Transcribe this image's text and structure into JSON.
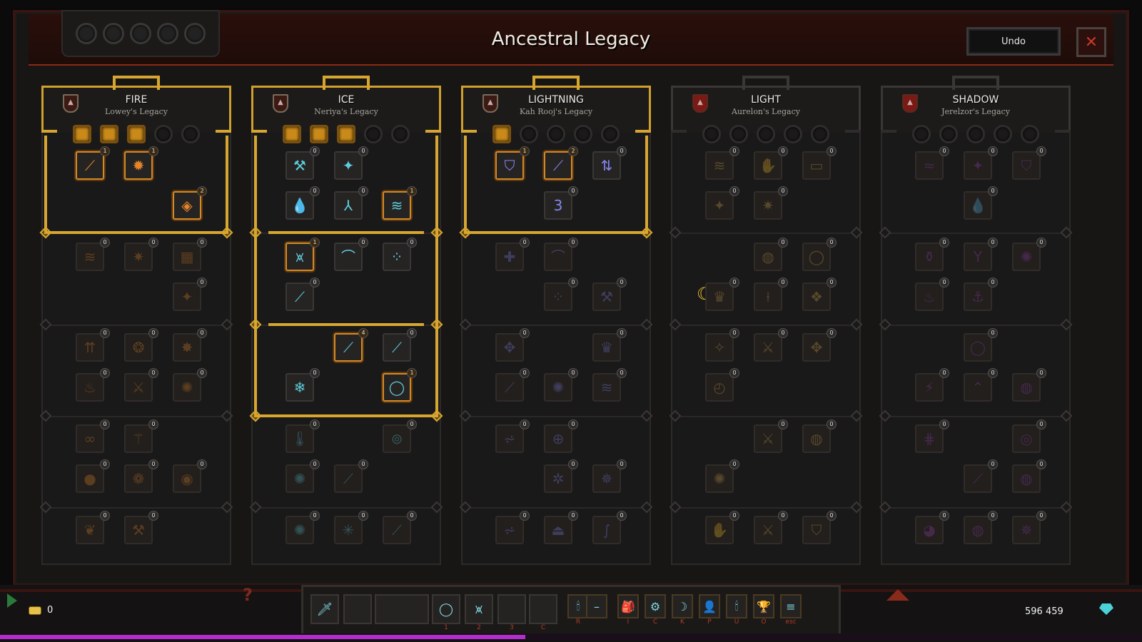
{
  "window": {
    "title": "Ancestral Legacy",
    "undo_label": "Undo",
    "close_icon": "✕"
  },
  "bottom": {
    "gold": "0",
    "currency": "596 459",
    "help": "?",
    "xp_fraction": 0.46
  },
  "hotbar": [
    {
      "key": "",
      "icon": "🗡"
    },
    {
      "key": "",
      "icon": ""
    },
    {
      "key": "",
      "icon": ""
    },
    {
      "key": "1",
      "icon": "◯"
    },
    {
      "key": "2",
      "icon": "⩙"
    },
    {
      "key": "3",
      "icon": ""
    },
    {
      "key": "C",
      "icon": ""
    },
    {
      "key": "R",
      "icon": "🕯"
    },
    {
      "key": "",
      "icon": "–"
    },
    {
      "key": "I",
      "icon": "🎒"
    },
    {
      "key": "C",
      "icon": "⚙"
    },
    {
      "key": "K",
      "icon": "☽"
    },
    {
      "key": "P",
      "icon": "👤"
    },
    {
      "key": "U",
      "icon": "🕯"
    },
    {
      "key": "O",
      "icon": "🏆"
    },
    {
      "key": "esc",
      "icon": "≡"
    }
  ],
  "columns": [
    {
      "id": "fire",
      "name": "FIRE",
      "legacy": "Lowey's Legacy",
      "color": "#f08a2a",
      "skills": [
        {
          "r": 0,
          "c": 0,
          "n": 1,
          "g": "⟋",
          "own": true
        },
        {
          "r": 0,
          "c": 1,
          "n": 1,
          "g": "✹",
          "own": true
        },
        {
          "r": 1,
          "c": 2,
          "n": 2,
          "g": "◈",
          "own": true
        },
        {
          "r": 2,
          "c": 0,
          "n": 0,
          "g": "≋"
        },
        {
          "r": 2,
          "c": 1,
          "n": 0,
          "g": "✷"
        },
        {
          "r": 2,
          "c": 2,
          "n": 0,
          "g": "▦"
        },
        {
          "r": 3,
          "c": 2,
          "n": 0,
          "g": "✦"
        },
        {
          "r": 4,
          "c": 0,
          "n": 0,
          "g": "⇈"
        },
        {
          "r": 4,
          "c": 1,
          "n": 0,
          "g": "❂"
        },
        {
          "r": 4,
          "c": 2,
          "n": 0,
          "g": "✸"
        },
        {
          "r": 5,
          "c": 0,
          "n": 0,
          "g": "♨"
        },
        {
          "r": 5,
          "c": 1,
          "n": 0,
          "g": "⚔"
        },
        {
          "r": 5,
          "c": 2,
          "n": 0,
          "g": "✺"
        },
        {
          "r": 6,
          "c": 0,
          "n": 0,
          "g": "∞"
        },
        {
          "r": 6,
          "c": 1,
          "n": 0,
          "g": "⚚"
        },
        {
          "r": 7,
          "c": 0,
          "n": 0,
          "g": "●"
        },
        {
          "r": 7,
          "c": 1,
          "n": 0,
          "g": "❁"
        },
        {
          "r": 7,
          "c": 2,
          "n": 0,
          "g": "◉"
        },
        {
          "r": 8,
          "c": 0,
          "n": 0,
          "g": "❦"
        },
        {
          "r": 8,
          "c": 1,
          "n": 0,
          "g": "⚒"
        }
      ]
    },
    {
      "id": "ice",
      "name": "ICE",
      "legacy": "Neriya's Legacy",
      "color": "#5fd6e8",
      "skills": [
        {
          "r": 0,
          "c": 0,
          "n": 0,
          "g": "⚒",
          "lit": true
        },
        {
          "r": 0,
          "c": 1,
          "n": 0,
          "g": "✦",
          "lit": true
        },
        {
          "r": 1,
          "c": 0,
          "n": 0,
          "g": "💧",
          "lit": true
        },
        {
          "r": 1,
          "c": 1,
          "n": 0,
          "g": "⅄",
          "lit": true
        },
        {
          "r": 1,
          "c": 2,
          "n": 1,
          "g": "≋",
          "own": true
        },
        {
          "r": 2,
          "c": 0,
          "n": 1,
          "g": "⩙",
          "own": true
        },
        {
          "r": 2,
          "c": 1,
          "n": 0,
          "g": "⌒",
          "lit": true
        },
        {
          "r": 2,
          "c": 2,
          "n": 0,
          "g": "⁘",
          "lit": true
        },
        {
          "r": 3,
          "c": 0,
          "n": 0,
          "g": "⟋",
          "lit": true
        },
        {
          "r": 4,
          "c": 1,
          "n": 4,
          "g": "⟋",
          "own": true
        },
        {
          "r": 4,
          "c": 2,
          "n": 0,
          "g": "⟋",
          "lit": true
        },
        {
          "r": 5,
          "c": 0,
          "n": 0,
          "g": "❄",
          "lit": true
        },
        {
          "r": 5,
          "c": 2,
          "n": 1,
          "g": "◯",
          "own": true
        },
        {
          "r": 6,
          "c": 0,
          "n": 0,
          "g": "🌡"
        },
        {
          "r": 6,
          "c": 2,
          "n": 0,
          "g": "⊚"
        },
        {
          "r": 7,
          "c": 0,
          "n": 0,
          "g": "✺"
        },
        {
          "r": 7,
          "c": 1,
          "n": 0,
          "g": "⟋"
        },
        {
          "r": 8,
          "c": 0,
          "n": 0,
          "g": "✺"
        },
        {
          "r": 8,
          "c": 1,
          "n": 0,
          "g": "✳"
        },
        {
          "r": 8,
          "c": 2,
          "n": 0,
          "g": "⟋"
        }
      ]
    },
    {
      "id": "lightning",
      "name": "LIGHTNING",
      "legacy": "Kah Rooj's Legacy",
      "color": "#8a8cff",
      "skills": [
        {
          "r": 0,
          "c": 0,
          "n": 1,
          "g": "⛉",
          "own": true
        },
        {
          "r": 0,
          "c": 1,
          "n": 2,
          "g": "⟋",
          "own": true
        },
        {
          "r": 0,
          "c": 2,
          "n": 0,
          "g": "⇅",
          "lit": true
        },
        {
          "r": 1,
          "c": 1,
          "n": 0,
          "g": "3",
          "lit": true
        },
        {
          "r": 2,
          "c": 0,
          "n": 0,
          "g": "✚"
        },
        {
          "r": 2,
          "c": 1,
          "n": 0,
          "g": "⌒"
        },
        {
          "r": 3,
          "c": 1,
          "n": 0,
          "g": "⁘"
        },
        {
          "r": 3,
          "c": 2,
          "n": 0,
          "g": "⚒"
        },
        {
          "r": 4,
          "c": 0,
          "n": 0,
          "g": "✥"
        },
        {
          "r": 4,
          "c": 2,
          "n": 0,
          "g": "♛"
        },
        {
          "r": 5,
          "c": 0,
          "n": 0,
          "g": "⟋"
        },
        {
          "r": 5,
          "c": 1,
          "n": 0,
          "g": "✺"
        },
        {
          "r": 5,
          "c": 2,
          "n": 0,
          "g": "≋"
        },
        {
          "r": 6,
          "c": 0,
          "n": 0,
          "g": "⩫"
        },
        {
          "r": 6,
          "c": 1,
          "n": 0,
          "g": "⊕"
        },
        {
          "r": 7,
          "c": 1,
          "n": 0,
          "g": "✲"
        },
        {
          "r": 7,
          "c": 2,
          "n": 0,
          "g": "✵"
        },
        {
          "r": 8,
          "c": 0,
          "n": 0,
          "g": "⩫"
        },
        {
          "r": 8,
          "c": 1,
          "n": 0,
          "g": "⏏"
        },
        {
          "r": 8,
          "c": 2,
          "n": 0,
          "g": "∫"
        }
      ]
    },
    {
      "id": "light",
      "name": "LIGHT",
      "legacy": "Aurelon's Legacy",
      "color": "#e0b050",
      "skills": [
        {
          "r": 0,
          "c": 0,
          "n": 0,
          "g": "≋"
        },
        {
          "r": 0,
          "c": 1,
          "n": 0,
          "g": "✋"
        },
        {
          "r": 0,
          "c": 2,
          "n": 0,
          "g": "▭"
        },
        {
          "r": 1,
          "c": 0,
          "n": 0,
          "g": "✦"
        },
        {
          "r": 1,
          "c": 1,
          "n": 0,
          "g": "✷"
        },
        {
          "r": 2,
          "c": 1,
          "n": 0,
          "g": "◍"
        },
        {
          "r": 2,
          "c": 2,
          "n": 0,
          "g": "◯"
        },
        {
          "r": 3,
          "c": 0,
          "n": 0,
          "g": "♛"
        },
        {
          "r": 3,
          "c": 1,
          "n": 0,
          "g": "⟊"
        },
        {
          "r": 3,
          "c": 2,
          "n": 0,
          "g": "❖"
        },
        {
          "r": 4,
          "c": 0,
          "n": 0,
          "g": "✧"
        },
        {
          "r": 4,
          "c": 1,
          "n": 0,
          "g": "⚔"
        },
        {
          "r": 4,
          "c": 2,
          "n": 0,
          "g": "✥"
        },
        {
          "r": 5,
          "c": 0,
          "n": 0,
          "g": "◴"
        },
        {
          "r": 6,
          "c": 1,
          "n": 0,
          "g": "⚔"
        },
        {
          "r": 6,
          "c": 2,
          "n": 0,
          "g": "◍"
        },
        {
          "r": 7,
          "c": 0,
          "n": 0,
          "g": "✺"
        },
        {
          "r": 8,
          "c": 0,
          "n": 0,
          "g": "✋"
        },
        {
          "r": 8,
          "c": 1,
          "n": 0,
          "g": "⚔"
        },
        {
          "r": 8,
          "c": 2,
          "n": 0,
          "g": "⛉"
        }
      ]
    },
    {
      "id": "shadow",
      "name": "SHADOW",
      "legacy": "Jerelzor's Legacy",
      "color": "#a040c0",
      "skills": [
        {
          "r": 0,
          "c": 0,
          "n": 0,
          "g": "≈"
        },
        {
          "r": 0,
          "c": 1,
          "n": 0,
          "g": "✦"
        },
        {
          "r": 0,
          "c": 2,
          "n": 0,
          "g": "⛉"
        },
        {
          "r": 1,
          "c": 1,
          "n": 0,
          "g": "💧"
        },
        {
          "r": 2,
          "c": 0,
          "n": 0,
          "g": "⚱"
        },
        {
          "r": 2,
          "c": 1,
          "n": 0,
          "g": "Y"
        },
        {
          "r": 2,
          "c": 2,
          "n": 0,
          "g": "✺"
        },
        {
          "r": 3,
          "c": 0,
          "n": 0,
          "g": "♨"
        },
        {
          "r": 3,
          "c": 1,
          "n": 0,
          "g": "⚓"
        },
        {
          "r": 4,
          "c": 1,
          "n": 0,
          "g": "◯"
        },
        {
          "r": 5,
          "c": 0,
          "n": 0,
          "g": "⚡"
        },
        {
          "r": 5,
          "c": 1,
          "n": 0,
          "g": "⌃"
        },
        {
          "r": 5,
          "c": 2,
          "n": 0,
          "g": "◍"
        },
        {
          "r": 6,
          "c": 0,
          "n": 0,
          "g": "⋕"
        },
        {
          "r": 6,
          "c": 2,
          "n": 0,
          "g": "◎"
        },
        {
          "r": 7,
          "c": 1,
          "n": 0,
          "g": "⟋"
        },
        {
          "r": 7,
          "c": 2,
          "n": 0,
          "g": "◍"
        },
        {
          "r": 8,
          "c": 0,
          "n": 0,
          "g": "◕"
        },
        {
          "r": 8,
          "c": 1,
          "n": 0,
          "g": "◍"
        },
        {
          "r": 8,
          "c": 2,
          "n": 0,
          "g": "✵"
        }
      ]
    }
  ]
}
